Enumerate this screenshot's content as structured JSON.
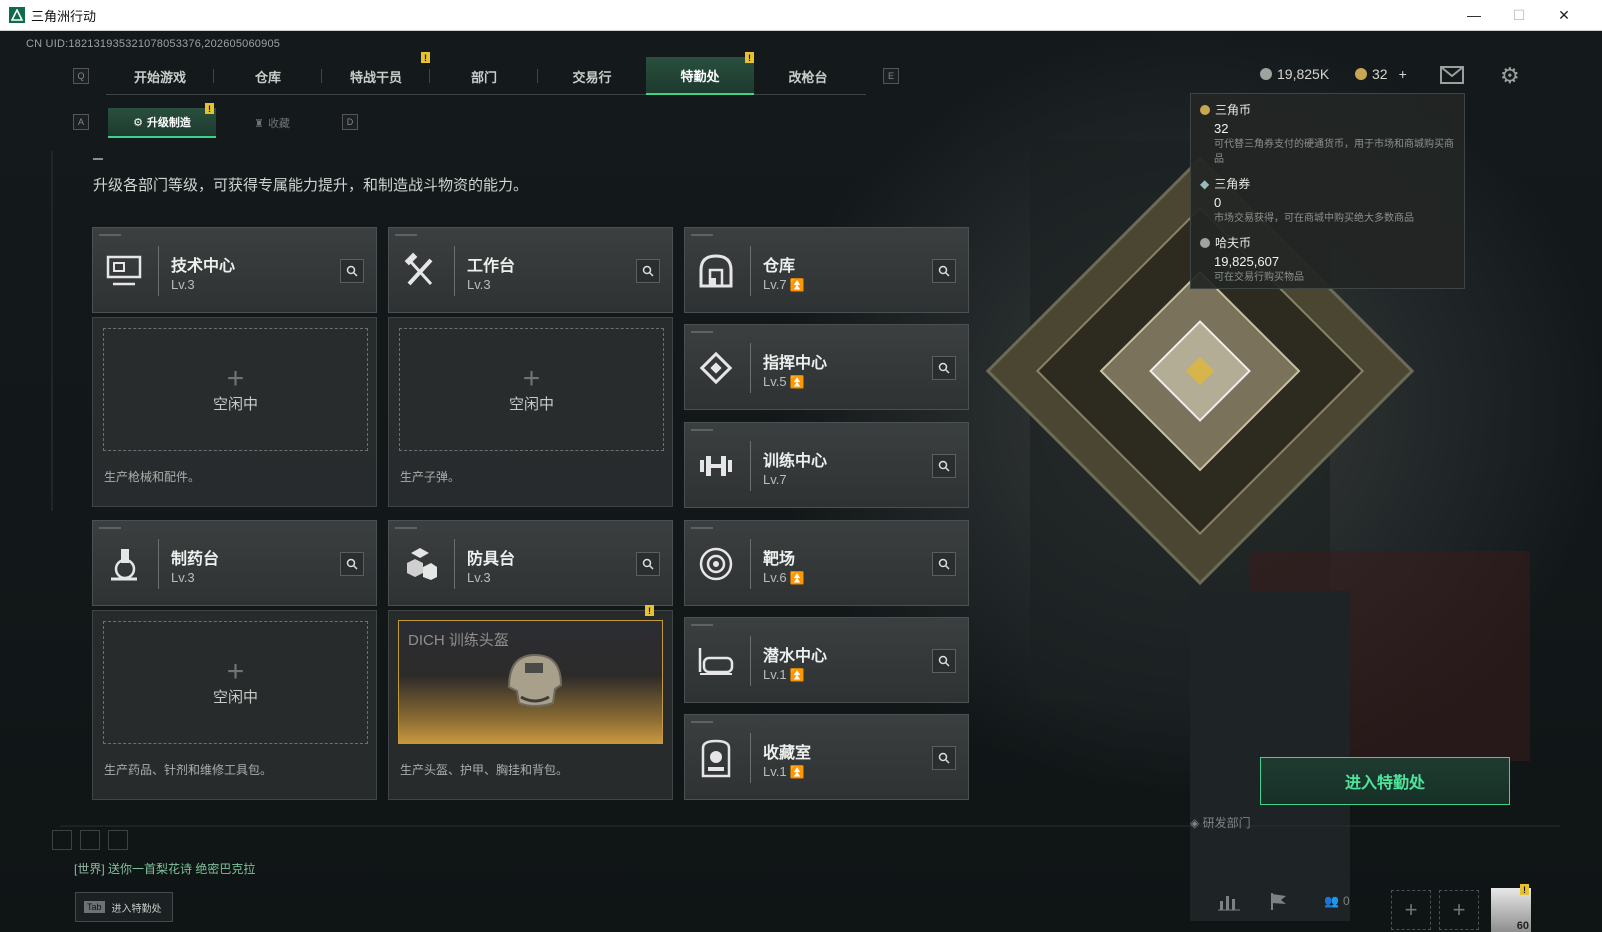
{
  "window": {
    "title": "三角洲行动",
    "uid": "CN UID:182131935321078053376,202605060905"
  },
  "nav": {
    "left_key": "Q",
    "right_key": "E",
    "tabs": [
      "开始游戏",
      "仓库",
      "特战干员",
      "部门",
      "交易行",
      "特勤处",
      "改枪台"
    ],
    "active_tab": "特勤处",
    "badges": {
      "tab_2": "!",
      "tab_5": "!"
    }
  },
  "subnav": {
    "left_key": "A",
    "right_key": "D",
    "tab_upgrade": "升级制造",
    "tab_collect": "收藏",
    "badge": "!"
  },
  "currency": {
    "hafu": "19,825K",
    "triangle_coin": "32",
    "add": "+"
  },
  "tooltip": {
    "coin_name": "三角币",
    "coin_value": "32",
    "coin_desc": "可代替三角券支付的硬通货币，用于市场和商城购买商品",
    "voucher_name": "三角券",
    "voucher_value": "0",
    "voucher_desc": "市场交易获得，可在商城中购买绝大多数商品",
    "hafu_name": "哈夫币",
    "hafu_value": "19,825,607",
    "hafu_desc": "可在交易行购买物品"
  },
  "description": "升级各部门等级，可获得专属能力提升，和制造战斗物资的能力。",
  "departments": {
    "tech": {
      "name": "技术中心",
      "level": "Lv.3"
    },
    "workbench": {
      "name": "工作台",
      "level": "Lv.3"
    },
    "warehouse": {
      "name": "仓库",
      "level": "Lv.7"
    },
    "command": {
      "name": "指挥中心",
      "level": "Lv.5"
    },
    "training": {
      "name": "训练中心",
      "level": "Lv.7"
    },
    "pharmacy": {
      "name": "制药台",
      "level": "Lv.3"
    },
    "armor": {
      "name": "防具台",
      "level": "Lv.3"
    },
    "range": {
      "name": "靶场",
      "level": "Lv.6"
    },
    "diving": {
      "name": "潜水中心",
      "level": "Lv.1"
    },
    "collection": {
      "name": "收藏室",
      "level": "Lv.1"
    }
  },
  "production": {
    "tech": {
      "status": "空闲中",
      "desc": "生产枪械和配件。"
    },
    "workbench": {
      "status": "空闲中",
      "desc": "生产子弹。"
    },
    "pharmacy": {
      "status": "空闲中",
      "desc": "生产药品、针剂和维修工具包。"
    },
    "armor": {
      "item": "DICH 训练头盔",
      "desc": "生产头盔、护甲、胸挂和背包。",
      "badge": "!"
    }
  },
  "enter_button": "进入特勤处",
  "building_label": "研发部门",
  "chat": {
    "channel": "[世界]",
    "text": "送你一首梨花诗  绝密巴克拉"
  },
  "tab_hint": {
    "key": "Tab",
    "label": "进入特勤处"
  },
  "bottom": {
    "friends": "0",
    "avatar_level": "60",
    "avatar_badge": "!"
  },
  "colors": {
    "accent": "#3fd28b",
    "badge": "#e6c230",
    "upgrade_arrow": "#e6c230"
  }
}
